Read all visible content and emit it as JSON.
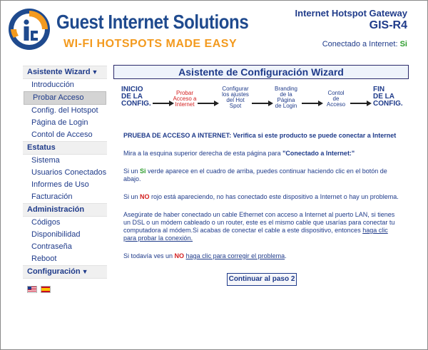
{
  "brand": {
    "name": "Guest Internet Solutions",
    "tagline": "WI-FI HOTSPOTS MADE EASY"
  },
  "header": {
    "product": "Internet Hotspot Gateway",
    "model": "GIS-R4",
    "connected_label": "Conectado a Internet:",
    "connected_value": "Si"
  },
  "sidebar": {
    "sections": [
      {
        "title": "Asistente Wizard",
        "items": [
          "Introducción",
          "Probar Acceso",
          "Config. del Hotspot",
          "Página de Login",
          "Contol de Acceso"
        ]
      },
      {
        "title": "Estatus",
        "items": [
          "Sistema",
          "Usuarios Conectados",
          "Informes de Uso",
          "Facturación"
        ]
      },
      {
        "title": "Administración",
        "items": [
          "Códigos",
          "Disponibilidad",
          "Contraseña",
          "Reboot"
        ]
      },
      {
        "title": "Configuración",
        "items": []
      }
    ],
    "active_item": "Probar Acceso"
  },
  "main": {
    "title": "Asistente de Configuración Wizard",
    "steps": [
      {
        "l1": "INICIO",
        "l2": "DE LA",
        "l3": "CONFIG."
      },
      {
        "l1": "Probar",
        "l2": "Acceso a",
        "l3": "Internet"
      },
      {
        "l1": "Configurar",
        "l2": "los ajustes",
        "l3": "del Hot",
        "l4": "Spot"
      },
      {
        "l1": "Branding",
        "l2": "de la",
        "l3": "Página",
        "l4": "de Login"
      },
      {
        "l1": "Contol",
        "l2": "de",
        "l3": "Acceso"
      },
      {
        "l1": "FIN",
        "l2": "DE LA",
        "l3": "CONFIG."
      }
    ],
    "lead": "PRUEBA DE ACCESO A INTERNET: Verifica si este producto se puede conectar a Internet",
    "p1_a": "Mira a la esquina superior derecha de esta página para ",
    "p1_b": "\"Conectado a Internet:\"",
    "p2_a": "Si un ",
    "p2_b": "Si",
    "p2_c": " verde aparece en el cuadro de arriba, puedes continuar haciendo clic en el botón de abajo.",
    "p3_a": "Si un ",
    "p3_b": "NO",
    "p3_c": " rojo está apareciendo, no has conectado este dispositivo a Internet o hay un problema.",
    "p4_a": "Asegúrate de haber conectado un cable Ethernet con acceso a Internet al puerto LAN, si tienes un DSL o un módem cableado o un router, este es el mismo cable que usarías para conectar tu computadora al módem.Si acabas de conectar el cable a este dispositivo, entonces ",
    "p4_link": "haga clic para probar la conexión.",
    "p5_a": "Si todavía ves un ",
    "p5_b": "NO",
    "p5_c": " ",
    "p5_link": "haga clic para corregir el problema",
    "p5_d": ".",
    "continue_label": "Continuar al paso 2"
  },
  "colors": {
    "brand_blue": "#1f4a8e",
    "accent_orange": "#f39a1e",
    "ok_green": "#2e9d2e",
    "error_red": "#d31f1f"
  }
}
